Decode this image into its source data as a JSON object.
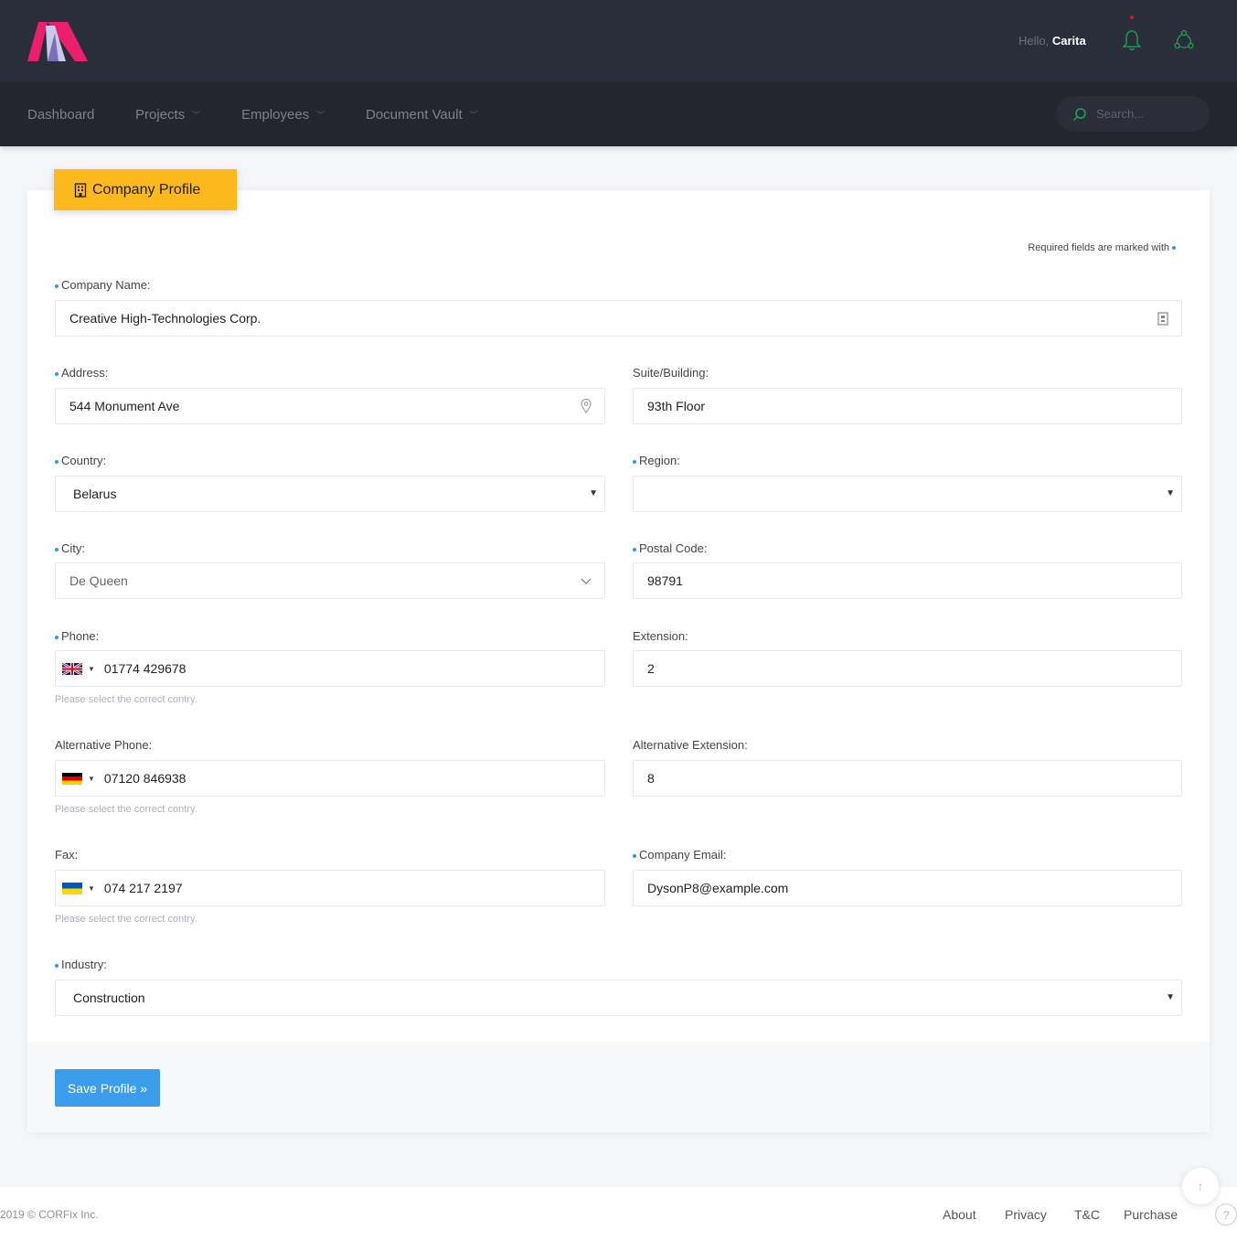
{
  "header": {
    "greeting": "Hello,",
    "user_name": "Carita",
    "accent_color": "#ec1f6c"
  },
  "nav": {
    "items": [
      {
        "label": "Dashboard",
        "has_menu": false
      },
      {
        "label": "Projects",
        "has_menu": true
      },
      {
        "label": "Employees",
        "has_menu": true
      },
      {
        "label": "Document Vault",
        "has_menu": true
      }
    ],
    "search_placeholder": "Search..."
  },
  "card": {
    "title": "Company Profile",
    "required_note": "Required fields are marked with"
  },
  "form": {
    "company_name": {
      "label": "Company Name:",
      "value": "Creative High-Technologies Corp."
    },
    "address": {
      "label": "Address:",
      "value": "544 Monument Ave"
    },
    "suite": {
      "label": "Suite/Building:",
      "value": "93th Floor"
    },
    "country": {
      "label": "Country:",
      "value": "Belarus"
    },
    "region": {
      "label": "Region:",
      "value": ""
    },
    "city": {
      "label": "City:",
      "value": "De Queen"
    },
    "postal_code": {
      "label": "Postal Code:",
      "value": "98791"
    },
    "phone": {
      "label": "Phone:",
      "value": "01774 429678",
      "flag": "uk-flag",
      "hint": "Please select the correct contry."
    },
    "extension": {
      "label": "Extension:",
      "value": "2"
    },
    "alt_phone": {
      "label": "Alternative Phone:",
      "value": "07120 846938",
      "flag": "germany-flag",
      "hint": "Please select the correct contry."
    },
    "alt_extension": {
      "label": "Alternative Extension:",
      "value": "8"
    },
    "fax": {
      "label": "Fax:",
      "value": "074 217 2197",
      "flag": "ukraine-flag",
      "hint": "Please select the correct contry."
    },
    "company_email": {
      "label": "Company Email:",
      "value": "DysonP8@example.com"
    },
    "industry": {
      "label": "Industry:",
      "value": "Construction"
    }
  },
  "actions": {
    "save_label": "Save Profile »",
    "save_color": "#3b9dec"
  },
  "footer": {
    "copyright": "2019 © CORFix Inc.",
    "links": [
      "About",
      "Privacy",
      "T&C",
      "Purchase"
    ]
  }
}
